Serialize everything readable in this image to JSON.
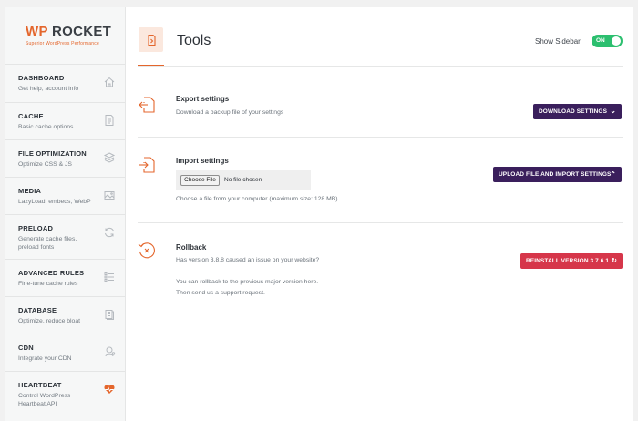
{
  "logo": {
    "brand_wp": "WP",
    "brand_rest": " ROCKET",
    "tagline": "Superior WordPress Performance"
  },
  "sidebar": {
    "items": [
      {
        "title": "DASHBOARD",
        "desc": "Get help, account info",
        "icon": "home-icon"
      },
      {
        "title": "CACHE",
        "desc": "Basic cache options",
        "icon": "document-icon"
      },
      {
        "title": "FILE OPTIMIZATION",
        "desc": "Optimize CSS & JS",
        "icon": "layers-icon"
      },
      {
        "title": "MEDIA",
        "desc": "LazyLoad, embeds, WebP",
        "icon": "image-icon"
      },
      {
        "title": "PRELOAD",
        "desc": "Generate cache files, preload fonts",
        "icon": "refresh-icon"
      },
      {
        "title": "ADVANCED RULES",
        "desc": "Fine-tune cache rules",
        "icon": "list-icon"
      },
      {
        "title": "DATABASE",
        "desc": "Optimize, reduce bloat",
        "icon": "database-icon"
      },
      {
        "title": "CDN",
        "desc": "Integrate your CDN",
        "icon": "cdn-icon"
      },
      {
        "title": "HEARTBEAT",
        "desc": "Control WordPress Heartbeat API",
        "icon": "heartbeat-icon"
      }
    ]
  },
  "header": {
    "title": "Tools",
    "sidebar_toggle_label": "Show Sidebar",
    "toggle_state": "ON"
  },
  "export": {
    "title": "Export settings",
    "desc": "Download a backup file of your settings",
    "button": "DOWNLOAD SETTINGS"
  },
  "import": {
    "title": "Import settings",
    "choose_button": "Choose File",
    "file_status": "No file chosen",
    "hint": "Choose a file from your computer (maximum size: 128 MB)",
    "button": "UPLOAD FILE AND IMPORT SETTINGS"
  },
  "rollback": {
    "title": "Rollback",
    "question": "Has version 3.8.8 caused an issue on your website?",
    "line1": "You can rollback to the previous major version here.",
    "line2": "Then send us a support request.",
    "button": "REINSTALL VERSION 3.7.6.1"
  },
  "colors": {
    "accent": "#e4662c",
    "button_dark": "#3a1f5c",
    "button_red": "#d6364a",
    "toggle_on": "#2cbf6f"
  }
}
